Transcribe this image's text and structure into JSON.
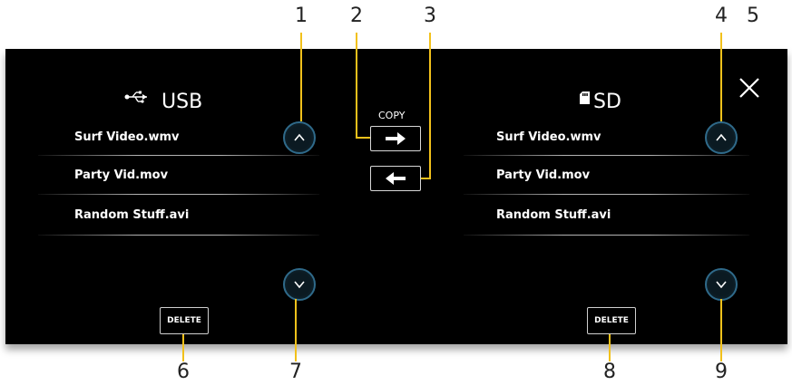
{
  "callouts": [
    "1",
    "2",
    "3",
    "4",
    "5",
    "6",
    "7",
    "8",
    "9"
  ],
  "accent_color": "#f2c11b",
  "usb_panel": {
    "icon": "usb-icon",
    "title": "USB",
    "files": [
      "Surf Video.wmv",
      "Party Vid.mov",
      "Random Stuff.avi"
    ],
    "delete_label": "DELETE"
  },
  "sd_panel": {
    "icon": "sd-card-icon",
    "title": "SD",
    "files": [
      "Surf Video.wmv",
      "Party Vid.mov",
      "Random Stuff.avi"
    ],
    "delete_label": "DELETE"
  },
  "center": {
    "copy_label": "COPY"
  },
  "icons": {
    "close": "close-icon",
    "scroll_up": "chevron-up-icon",
    "scroll_down": "chevron-down-icon",
    "copy_right": "arrow-right-icon",
    "copy_left": "arrow-left-icon"
  }
}
